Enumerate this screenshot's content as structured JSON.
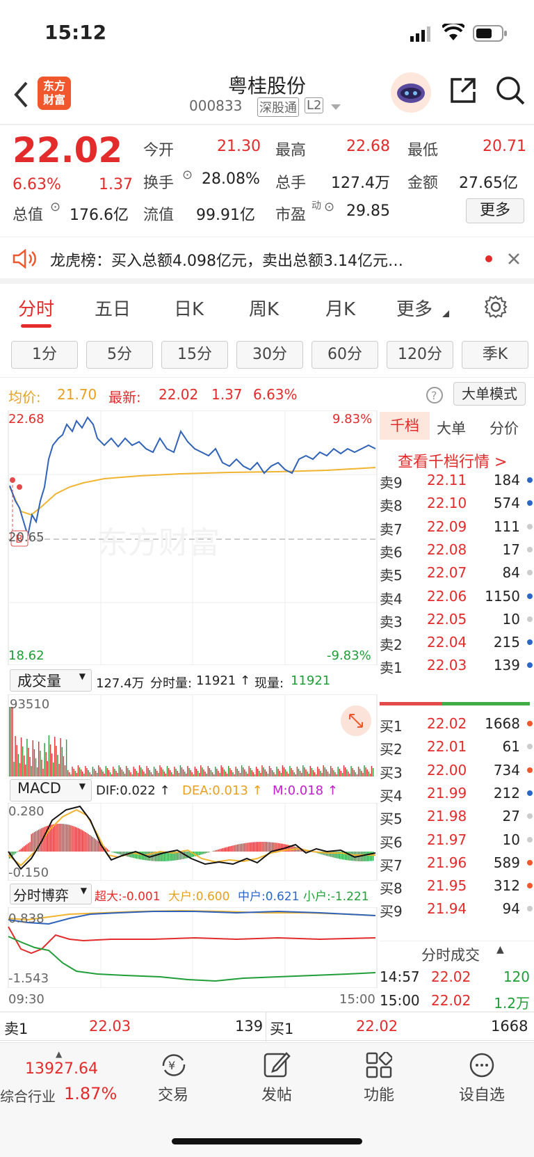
{
  "status": {
    "time": "15:12"
  },
  "header": {
    "title": "粤桂股份",
    "code": "000833",
    "tag1": "深股通",
    "tag2": "L2"
  },
  "logo": {
    "line1": "东方",
    "line2": "财富"
  },
  "quote": {
    "price": "22.02",
    "pct": "6.63%",
    "chg": "1.37",
    "open_l": "今开",
    "open": "21.30",
    "high_l": "最高",
    "high": "22.68",
    "low_l": "最低",
    "low": "20.71",
    "turn_l": "换手",
    "turn": "28.08%",
    "vol_l": "总手",
    "vol": "127.4万",
    "amt_l": "金额",
    "amt": "27.65亿",
    "mcap_l": "总值",
    "mcap": "176.6亿",
    "fmcap_l": "流值",
    "fmcap": "99.91亿",
    "pe_l": "市盈",
    "pe_sup": "动",
    "pe": "29.85",
    "more": "更多"
  },
  "notice": {
    "text": "龙虎榜：买入总额4.098亿元，卖出总额3.14亿元…"
  },
  "tabs": [
    "分时",
    "五日",
    "日K",
    "周K",
    "月K",
    "更多"
  ],
  "periods": [
    "1分",
    "5分",
    "15分",
    "30分",
    "60分",
    "120分",
    "季K"
  ],
  "info": {
    "avg_l": "均价:",
    "avg": "21.70",
    "last_l": "最新:",
    "last": "22.02",
    "chg": "1.37",
    "pct": "6.63%",
    "mode": "大单模式"
  },
  "chart": {
    "ymax": "22.68",
    "ymid": "20.65",
    "ymin": "18.62",
    "pmax": "9.83%",
    "pmin": "-9.83%",
    "watermark": "东方财富",
    "b_mark": "B"
  },
  "vol": {
    "sel": "成交量",
    "total": "127.4万",
    "fs_l": "分时量:",
    "fs": "11921 ↑",
    "cur_l": "现量:",
    "cur": "11921",
    "ymax": "93510"
  },
  "macd": {
    "sel": "MACD",
    "dif": "DIF:0.022 ↑",
    "dea": "DEA:0.013 ↑",
    "m": "M:0.018 ↑",
    "ymax": "0.280",
    "ymin": "-0.150"
  },
  "boyi": {
    "sel": "分时博弈",
    "cd": "超大:-0.001",
    "dh": "大户:0.600",
    "zh": "中户:0.621",
    "xh": "小户:-1.221",
    "ymax": "0.838",
    "ymin": "-1.543",
    "t0": "09:30",
    "t1": "15:00"
  },
  "ob_tabs": [
    "千档",
    "大单",
    "分价"
  ],
  "ob_link": "查看千档行情 >",
  "sells": [
    [
      "卖9",
      "22.11",
      "184"
    ],
    [
      "卖8",
      "22.10",
      "574"
    ],
    [
      "卖7",
      "22.09",
      "111"
    ],
    [
      "卖6",
      "22.08",
      "17"
    ],
    [
      "卖5",
      "22.07",
      "84"
    ],
    [
      "卖4",
      "22.06",
      "1150"
    ],
    [
      "卖3",
      "22.05",
      "10"
    ],
    [
      "卖2",
      "22.04",
      "215"
    ],
    [
      "卖1",
      "22.03",
      "139"
    ]
  ],
  "buys": [
    [
      "买1",
      "22.02",
      "1668"
    ],
    [
      "买2",
      "22.01",
      "61"
    ],
    [
      "买3",
      "22.00",
      "734"
    ],
    [
      "买4",
      "21.99",
      "212"
    ],
    [
      "买5",
      "21.98",
      "27"
    ],
    [
      "买6",
      "21.97",
      "10"
    ],
    [
      "买7",
      "21.96",
      "589"
    ],
    [
      "买8",
      "21.95",
      "312"
    ],
    [
      "买9",
      "21.94",
      "94"
    ]
  ],
  "trades_title": "分时成交",
  "trades": [
    [
      "14:57",
      "22.02",
      "120"
    ],
    [
      "15:00",
      "22.02",
      "1.2万"
    ]
  ],
  "bar": {
    "s_l": "卖1",
    "s_p": "22.03",
    "s_v": "139",
    "b_l": "买1",
    "b_p": "22.02",
    "b_v": "1668"
  },
  "bottom": {
    "index": "13927.64",
    "ind_l": "综合行业",
    "ind_pct": "1.87%",
    "trade": "交易",
    "post": "发帖",
    "func": "功能",
    "fav": "设自选"
  }
}
